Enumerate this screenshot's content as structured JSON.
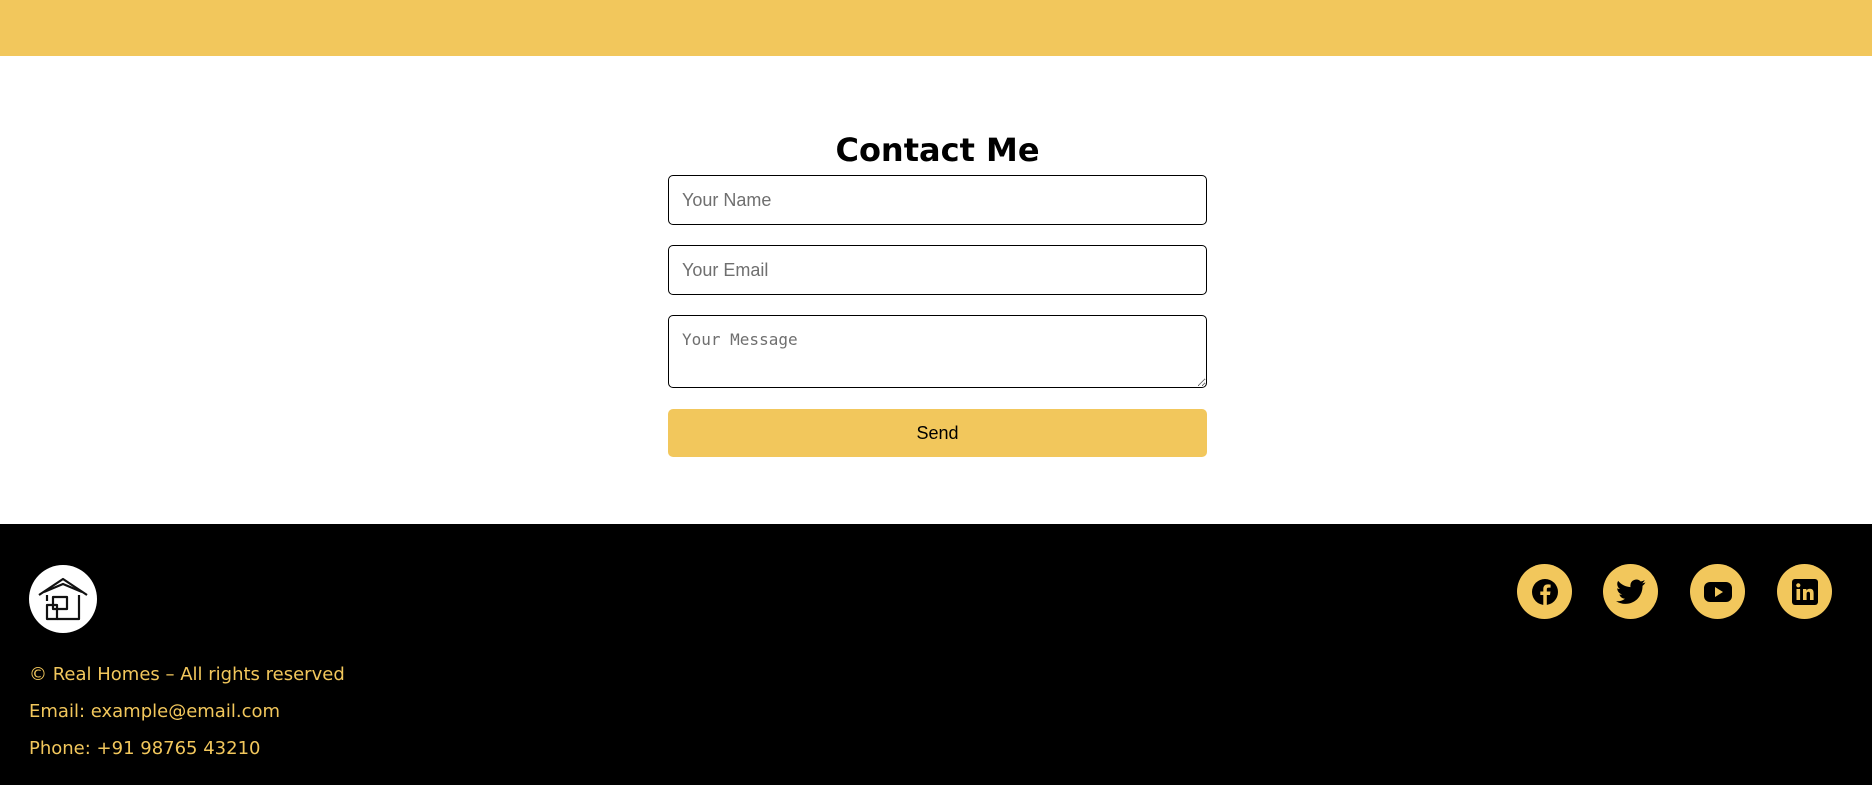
{
  "colors": {
    "accent": "#f2c75c",
    "footer_bg": "#000000",
    "page_bg": "#ffffff"
  },
  "contact": {
    "title": "Contact Me",
    "name_placeholder": "Your Name",
    "email_placeholder": "Your Email",
    "message_placeholder": "Your Message",
    "send_label": "Send"
  },
  "footer": {
    "logo_icon": "house-logo-icon",
    "copyright": "© Real Homes – All rights reserved",
    "email": "Email: example@email.com",
    "phone": "Phone: +91 98765 43210",
    "social": [
      {
        "icon": "facebook-icon"
      },
      {
        "icon": "twitter-icon"
      },
      {
        "icon": "youtube-icon"
      },
      {
        "icon": "linkedin-icon"
      }
    ]
  }
}
